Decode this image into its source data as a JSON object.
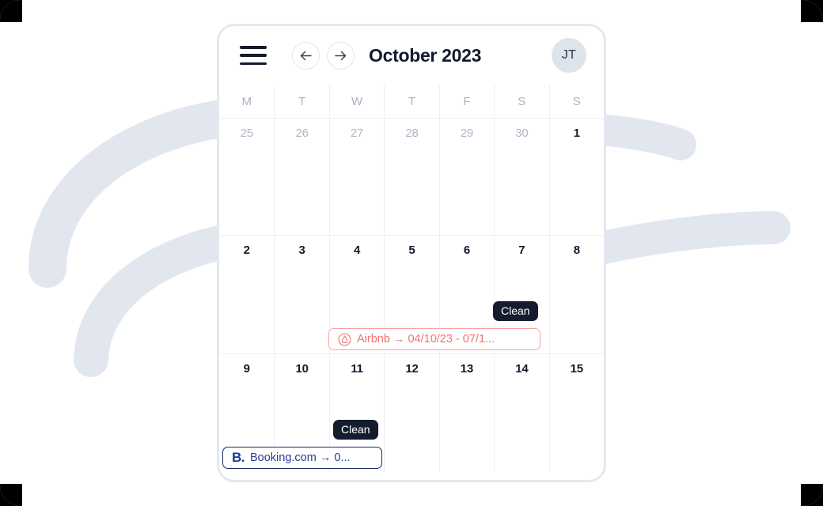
{
  "header": {
    "menu_icon": "hamburger-menu-icon",
    "prev_icon": "arrow-left-icon",
    "next_icon": "arrow-right-icon",
    "title": "October 2023",
    "avatar_initials": "JT"
  },
  "calendar": {
    "weekdays": [
      "M",
      "T",
      "W",
      "T",
      "F",
      "S",
      "S"
    ],
    "weeks": [
      {
        "days": [
          {
            "num": "25",
            "muted": true
          },
          {
            "num": "26",
            "muted": true
          },
          {
            "num": "27",
            "muted": true
          },
          {
            "num": "28",
            "muted": true
          },
          {
            "num": "29",
            "muted": true
          },
          {
            "num": "30",
            "muted": true
          },
          {
            "num": "1",
            "muted": false
          }
        ]
      },
      {
        "days": [
          {
            "num": "2",
            "muted": false
          },
          {
            "num": "3",
            "muted": false
          },
          {
            "num": "4",
            "muted": false
          },
          {
            "num": "5",
            "muted": false
          },
          {
            "num": "6",
            "muted": false
          },
          {
            "num": "7",
            "muted": false
          },
          {
            "num": "8",
            "muted": false
          }
        ]
      },
      {
        "days": [
          {
            "num": "9",
            "muted": false
          },
          {
            "num": "10",
            "muted": false
          },
          {
            "num": "11",
            "muted": false
          },
          {
            "num": "12",
            "muted": false
          },
          {
            "num": "13",
            "muted": false
          },
          {
            "num": "14",
            "muted": false
          },
          {
            "num": "15",
            "muted": false
          }
        ]
      }
    ]
  },
  "events": {
    "week2": {
      "clean_badge": "Clean",
      "booking": {
        "source_icon": "airbnb-logo-icon",
        "label": "Airbnb → 04/10/23 - 07/1...",
        "color": "#f2706f",
        "border_color": "#f7a3a3"
      }
    },
    "week3": {
      "clean_badge": "Clean",
      "booking": {
        "source_icon": "booking-com-logo-icon",
        "logo_text": "B.",
        "label": "Booking.com → 0...",
        "color": "#24408f",
        "border_color": "#1b2b65"
      }
    }
  },
  "theme": {
    "card_border": "#e4e8f0",
    "grid_line": "#eceff5",
    "muted_text": "#aeb7c9",
    "dark_text": "#121a2d",
    "badge_bg": "#141c2e",
    "decor_color": "#e2e7ef",
    "avatar_bg": "#dfe4ec"
  }
}
